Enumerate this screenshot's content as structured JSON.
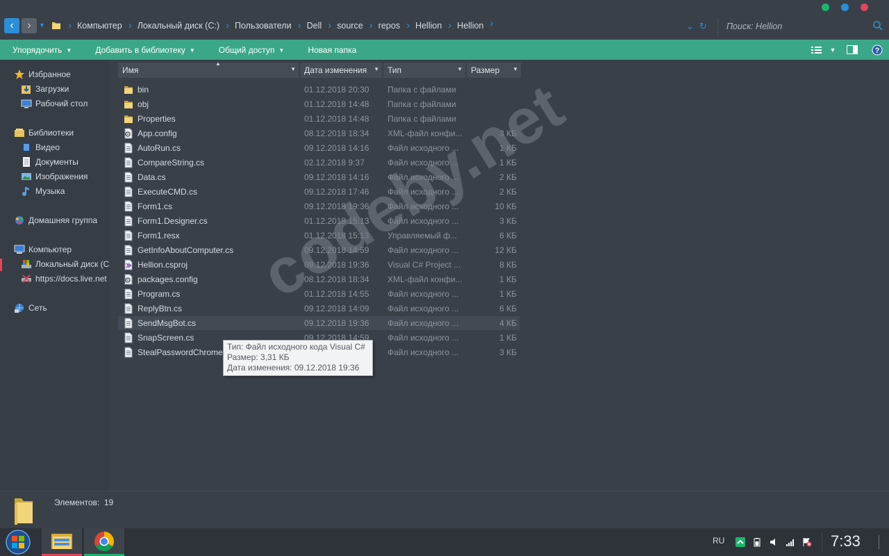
{
  "address": {
    "crumbs": [
      "Компьютер",
      "Локальный диск (C:)",
      "Пользователи",
      "Dell",
      "source",
      "repos",
      "Hellion",
      "Hellion"
    ],
    "search_placeholder": "Поиск: Hellion"
  },
  "toolbar": {
    "organize": "Упорядочить",
    "add_to_library": "Добавить в библиотеку",
    "share": "Общий доступ",
    "new_folder": "Новая папка"
  },
  "nav": {
    "favorites": "Избранное",
    "downloads": "Загрузки",
    "desktop": "Рабочий стол",
    "libraries": "Библиотеки",
    "video": "Видео",
    "documents": "Документы",
    "images": "Изображения",
    "music": "Музыка",
    "homegroup": "Домашняя группа",
    "computer": "Компьютер",
    "local_disk": "Локальный диск (C:)",
    "onedrive": "https://docs.live.net",
    "network": "Сеть"
  },
  "columns": {
    "name": "Имя",
    "date": "Дата изменения",
    "type": "Тип",
    "size": "Размер"
  },
  "files": [
    {
      "name": "bin",
      "date": "01.12.2018 20:30",
      "type": "Папка с файлами",
      "size": "",
      "icon": "folder"
    },
    {
      "name": "obj",
      "date": "01.12.2018 14:48",
      "type": "Папка с файлами",
      "size": "",
      "icon": "folder"
    },
    {
      "name": "Properties",
      "date": "01.12.2018 14:48",
      "type": "Папка с файлами",
      "size": "",
      "icon": "folder"
    },
    {
      "name": "App.config",
      "date": "08.12.2018 18:34",
      "type": "XML-файл конфи...",
      "size": "3 КБ",
      "icon": "config"
    },
    {
      "name": "AutoRun.cs",
      "date": "09.12.2018 14:16",
      "type": "Файл исходного ...",
      "size": "1 КБ",
      "icon": "code"
    },
    {
      "name": "CompareString.cs",
      "date": "02.12.2018 9:37",
      "type": "Файл исходного ...",
      "size": "1 КБ",
      "icon": "code"
    },
    {
      "name": "Data.cs",
      "date": "09.12.2018 14:16",
      "type": "Файл исходного ...",
      "size": "2 КБ",
      "icon": "code"
    },
    {
      "name": "ExecuteCMD.cs",
      "date": "09.12.2018 17:46",
      "type": "Файл исходного ...",
      "size": "2 КБ",
      "icon": "code"
    },
    {
      "name": "Form1.cs",
      "date": "09.12.2018 19:36",
      "type": "Файл исходного ...",
      "size": "10 КБ",
      "icon": "code"
    },
    {
      "name": "Form1.Designer.cs",
      "date": "01.12.2018 15:13",
      "type": "Файл исходного ...",
      "size": "3 КБ",
      "icon": "code"
    },
    {
      "name": "Form1.resx",
      "date": "01.12.2018 15:13",
      "type": "Управляемый ф...",
      "size": "6 КБ",
      "icon": "code"
    },
    {
      "name": "GetInfoAboutComputer.cs",
      "date": "09.12.2018 14:59",
      "type": "Файл исходного ...",
      "size": "12 КБ",
      "icon": "code"
    },
    {
      "name": "Hellion.csproj",
      "date": "09.12.2018 19:36",
      "type": "Visual C# Project ...",
      "size": "8 КБ",
      "icon": "csproj"
    },
    {
      "name": "packages.config",
      "date": "08.12.2018 18:34",
      "type": "XML-файл конфи...",
      "size": "1 КБ",
      "icon": "config"
    },
    {
      "name": "Program.cs",
      "date": "01.12.2018 14:55",
      "type": "Файл исходного ...",
      "size": "1 КБ",
      "icon": "code"
    },
    {
      "name": "ReplyBtn.cs",
      "date": "09.12.2018 14:09",
      "type": "Файл исходного ...",
      "size": "6 КБ",
      "icon": "code"
    },
    {
      "name": "SendMsgBot.cs",
      "date": "09.12.2018 19:36",
      "type": "Файл исходного ...",
      "size": "4 КБ",
      "icon": "code"
    },
    {
      "name": "SnapScreen.cs",
      "date": "09.12.2018 14:59",
      "type": "Файл исходного ...",
      "size": "1 КБ",
      "icon": "code"
    },
    {
      "name": "StealPasswordChrome.cs",
      "date": "",
      "type": "Файл исходного ...",
      "size": "3 КБ",
      "icon": "code"
    }
  ],
  "hovered_file": "SendMsgBot.cs",
  "tooltip": {
    "type": "Тип: Файл исходного кода Visual C#",
    "size": "Размер: 3,31 КБ",
    "date": "Дата изменения: 09.12.2018 19:36"
  },
  "watermark": "codeby.net",
  "details": {
    "count_label": "Элементов:",
    "count": "19"
  },
  "taskbar": {
    "lang": "RU",
    "clock": "7:33"
  },
  "colors": {
    "accent_green": "#3aa789",
    "accent_blue": "#2a8fd8",
    "accent_red": "#e0455a",
    "background": "#3a4048"
  }
}
